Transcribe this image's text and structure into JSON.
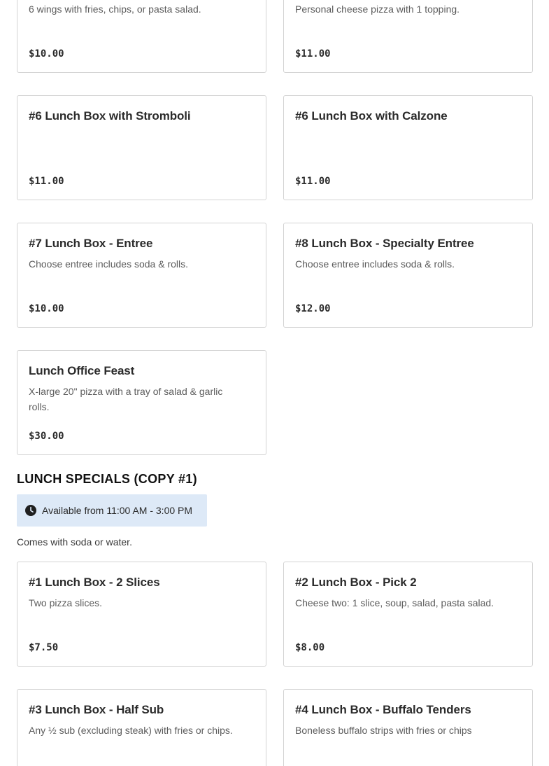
{
  "upper_menu": {
    "items": [
      {
        "title": "",
        "description": "6 wings with fries, chips, or pasta salad.",
        "price": "$10.00"
      },
      {
        "title": "",
        "description": "Personal cheese pizza with 1 topping.",
        "price": "$11.00"
      },
      {
        "title": "#6 Lunch Box with Stromboli",
        "description": "",
        "price": "$11.00"
      },
      {
        "title": "#6 Lunch Box with Calzone",
        "description": "",
        "price": "$11.00"
      },
      {
        "title": "#7 Lunch Box - Entree",
        "description": "Choose entree includes soda & rolls.",
        "price": "$10.00"
      },
      {
        "title": "#8 Lunch Box - Specialty Entree",
        "description": "Choose entree includes soda & rolls.",
        "price": "$12.00"
      },
      {
        "title": "Lunch Office Feast",
        "description": "X-large 20\" pizza with a tray of salad & garlic rolls.",
        "price": "$30.00"
      }
    ]
  },
  "lunch_specials_copy": {
    "title": "LUNCH SPECIALS (COPY #1)",
    "availability": {
      "icon": "clock-icon",
      "text": "Available from 11:00 AM - 3:00 PM"
    },
    "note": "Comes with soda or water.",
    "items": [
      {
        "title": "#1 Lunch Box - 2 Slices",
        "description": "Two pizza slices.",
        "price": "$7.50"
      },
      {
        "title": "#2 Lunch Box - Pick 2",
        "description": "Cheese two: 1 slice, soup, salad, pasta salad.",
        "price": "$8.00"
      },
      {
        "title": "#3 Lunch Box - Half Sub",
        "description": "Any ½ sub (excluding steak) with fries or chips.",
        "price": ""
      },
      {
        "title": "#4 Lunch Box - Buffalo Tenders",
        "description": "Boneless buffalo strips with fries or chips",
        "price": ""
      }
    ]
  },
  "colors": {
    "availability_background": "#dde9f7",
    "card_border": "#d3d3d3",
    "description_text": "#5c5c5c"
  }
}
